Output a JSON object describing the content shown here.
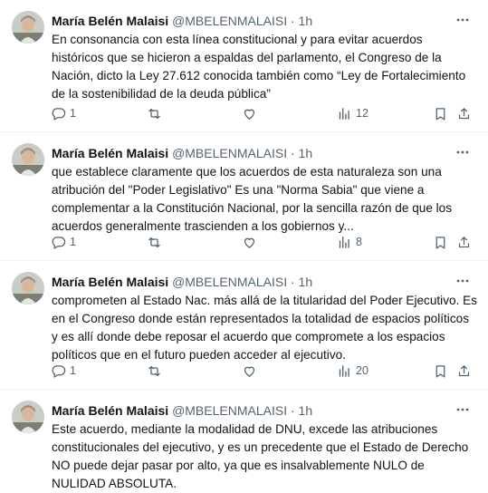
{
  "tweets": [
    {
      "author": "María Belén Malaisi",
      "handle": "@MBELENMALAISI",
      "separator": "·",
      "time": "1h",
      "text": "En consonancia con esta línea constitucional y para evitar acuerdos históricos que se hicieron a espaldas del parlamento, el Congreso de la Nación, dicto la Ley  27.612 conocida también como  “Ley de Fortalecimiento de la sostenibilidad de la deuda pública”",
      "replies": "1",
      "retweets": "",
      "likes": "",
      "views": "12"
    },
    {
      "author": "María Belén Malaisi",
      "handle": "@MBELENMALAISI",
      "separator": "·",
      "time": "1h",
      "text": "que establece claramente que los acuerdos de esta naturaleza son una atribución del \"Poder Legislativo\" Es una \"Norma Sabia\" que viene a complementar  a la Constitución Nacional, por la sencilla razón de que los acuerdos generalmente trascienden a los gobiernos y...",
      "replies": "1",
      "retweets": "",
      "likes": "",
      "views": "8"
    },
    {
      "author": "María Belén Malaisi",
      "handle": "@MBELENMALAISI",
      "separator": "·",
      "time": "1h",
      "text": "comprometen al Estado Nac. más allá de la titularidad del Poder Ejecutivo. Es en el Congreso donde están representados la totalidad de espacios políticos y es allí donde debe reposar el acuerdo que compromete a los espacios políticos que en el futuro pueden acceder al ejecutivo.",
      "replies": "1",
      "retweets": "",
      "likes": "",
      "views": "20"
    },
    {
      "author": "María Belén Malaisi",
      "handle": "@MBELENMALAISI",
      "separator": "·",
      "time": "1h",
      "text": "Este acuerdo, mediante la modalidad de DNU, excede las atribuciones constitucionales del ejecutivo, y es un precedente que el Estado de Derecho NO  puede dejar pasar por alto, ya que es insalvablemente NULO  de NULIDAD ABSOLUTA.",
      "replies": "",
      "retweets": "",
      "likes": "",
      "views": ""
    }
  ],
  "icons": [
    "avatar",
    "more-icon",
    "reply-icon",
    "retweet-icon",
    "like-icon",
    "views-icon",
    "bookmark-icon",
    "share-icon"
  ]
}
